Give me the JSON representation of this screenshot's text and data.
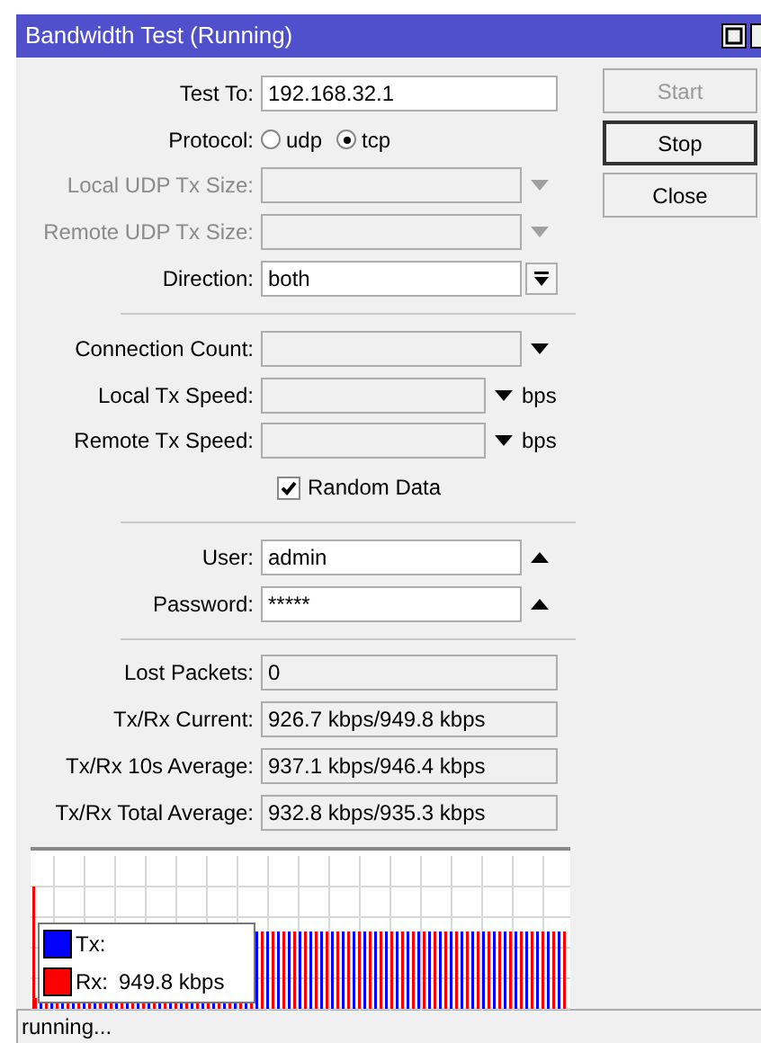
{
  "window": {
    "title": "Bandwidth Test (Running)"
  },
  "buttons": [
    {
      "label": "Start",
      "disabled": true,
      "selected": false
    },
    {
      "label": "Stop",
      "disabled": false,
      "selected": true
    },
    {
      "label": "Close",
      "disabled": false,
      "selected": false
    }
  ],
  "fields": [
    {
      "kind": "text",
      "label": "Test To:",
      "value": "192.168.32.1"
    },
    {
      "kind": "radio",
      "label": "Protocol:",
      "options": [
        {
          "label": "udp",
          "selected": false
        },
        {
          "label": "tcp",
          "selected": true
        }
      ]
    },
    {
      "kind": "combo",
      "label": "Local UDP Tx Size:",
      "disabled": true,
      "expanded": false
    },
    {
      "kind": "combo",
      "label": "Remote UDP Tx Size:",
      "disabled": true,
      "expanded": false
    },
    {
      "kind": "select",
      "label": "Direction:",
      "value": "both"
    },
    {
      "kind": "separator"
    },
    {
      "kind": "combo",
      "label": "Connection Count:",
      "disabled": false,
      "expanded": false
    },
    {
      "kind": "combo",
      "label": "Local Tx Speed:",
      "disabled": false,
      "expanded": false,
      "unit": "bps"
    },
    {
      "kind": "combo",
      "label": "Remote Tx Speed:",
      "disabled": false,
      "expanded": false,
      "unit": "bps"
    },
    {
      "kind": "checkbox",
      "label": "Random Data",
      "checked": true
    },
    {
      "kind": "separator"
    },
    {
      "kind": "combo",
      "label": "User:",
      "value": "admin",
      "disabled": false,
      "expanded": true
    },
    {
      "kind": "combo",
      "label": "Password:",
      "value": "*****",
      "disabled": false,
      "expanded": true
    },
    {
      "kind": "separator"
    },
    {
      "kind": "readonly",
      "label": "Lost Packets:",
      "value": "0"
    },
    {
      "kind": "readonly",
      "label": "Tx/Rx Current:",
      "value": "926.7 kbps/949.8 kbps"
    },
    {
      "kind": "readonly",
      "label": "Tx/Rx 10s Average:",
      "value": "937.1 kbps/946.4 kbps"
    },
    {
      "kind": "readonly",
      "label": "Tx/Rx Total Average:",
      "value": "932.8 kbps/935.3 kbps"
    }
  ],
  "graph": {
    "legend": [
      {
        "label": "Tx:",
        "color": "#0000ff"
      },
      {
        "label": "Rx:",
        "reading": "949.8 kbps",
        "color": "#ff0000"
      }
    ]
  },
  "status_bar": "running..."
}
